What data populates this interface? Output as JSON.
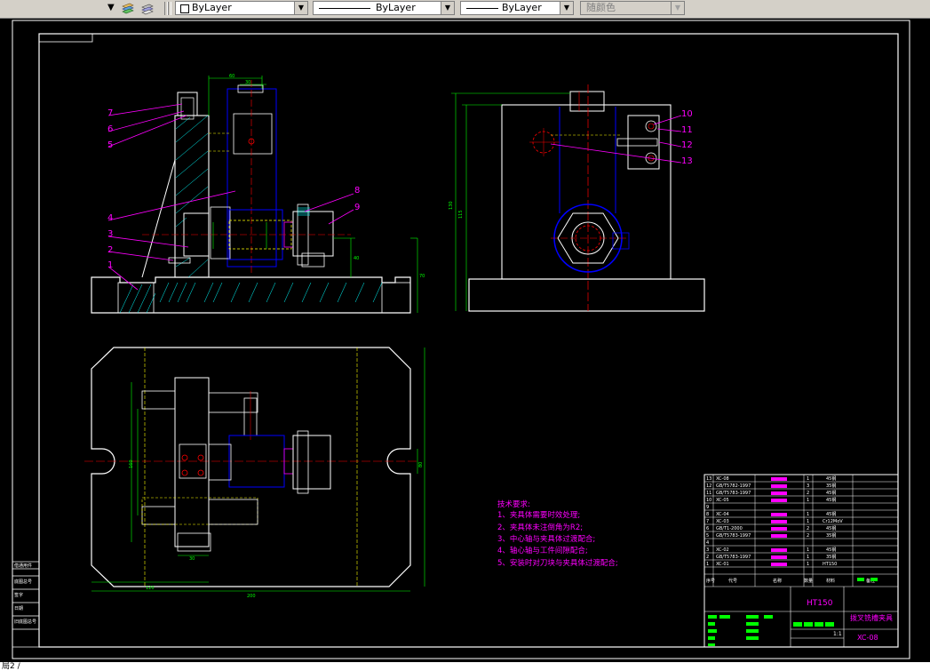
{
  "toolbar": {
    "color_combo": "ByLayer",
    "linetype_combo": "ByLayer",
    "lineweight_combo": "ByLayer",
    "plotstyle_combo": "随颜色"
  },
  "drawing": {
    "part_labels": [
      "1",
      "2",
      "3",
      "4",
      "5",
      "6",
      "7",
      "8",
      "9",
      "10",
      "11",
      "12",
      "13"
    ],
    "dims": {
      "d60": "60",
      "d120": "120",
      "d40": "40",
      "d70": "70",
      "d115": "115",
      "d30": "30",
      "d130": "130",
      "d200": "200",
      "d160": "160",
      "d80": "80"
    },
    "tech_req": {
      "title": "技术要求:",
      "lines": [
        "1、夹具体需要时效处理;",
        "2、夹具体未注倒角为R2;",
        "3、中心轴与夹具体过渡配合;",
        "4、轴心轴与工件间隙配合;",
        "5、安装时对刀块与夹具体过渡配合;"
      ]
    },
    "bom_rows": [
      {
        "no": "13",
        "code": "XC-08",
        "qty": "1",
        "mat": "45钢"
      },
      {
        "no": "12",
        "code": "GB/T5782-1997",
        "qty": "3",
        "mat": "35钢"
      },
      {
        "no": "11",
        "code": "GB/T5783-1997",
        "qty": "2",
        "mat": "45钢"
      },
      {
        "no": "10",
        "code": "XC-05",
        "qty": "1",
        "mat": "45钢"
      },
      {
        "no": "9",
        "code": "",
        "qty": "",
        "mat": ""
      },
      {
        "no": "8",
        "code": "XC-04",
        "qty": "1",
        "mat": "45钢"
      },
      {
        "no": "7",
        "code": "XC-03",
        "qty": "1",
        "mat": "Cr12MoV"
      },
      {
        "no": "6",
        "code": "GB/T1-2000",
        "qty": "2",
        "mat": "45钢"
      },
      {
        "no": "5",
        "code": "GB/T5783-1997",
        "qty": "2",
        "mat": "35钢"
      },
      {
        "no": "4",
        "code": "",
        "qty": "",
        "mat": ""
      },
      {
        "no": "3",
        "code": "XC-02",
        "qty": "1",
        "mat": "45钢"
      },
      {
        "no": "2",
        "code": "GB/T5783-1997",
        "qty": "1",
        "mat": "35钢"
      },
      {
        "no": "1",
        "code": "XC-01",
        "qty": "1",
        "mat": "HT150"
      }
    ],
    "title_block": {
      "material": "HT150",
      "name": "拨叉铣槽夹具",
      "drawing_no": "XC-08",
      "scale": "1:1",
      "header_cols": [
        "序号",
        "代号",
        "名称",
        "数量",
        "材料",
        "备注"
      ]
    },
    "left_stamps": [
      "借通用件",
      "底图总号",
      "签字",
      "日期",
      "旧底图总号"
    ]
  },
  "status": {
    "cmd_text": "局2 /"
  },
  "colors": {
    "paper": "#000000",
    "border": "#ffffff",
    "label": "#ff00ff",
    "center": "#ff0000",
    "hidden": "#ffff00",
    "dim": "#00ff00",
    "blue": "#0000ff",
    "cyan": "#00ffff"
  }
}
